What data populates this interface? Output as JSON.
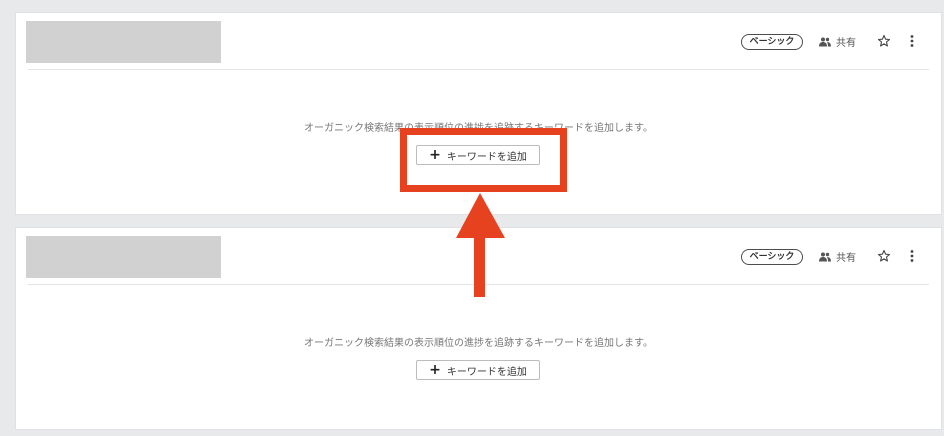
{
  "projects": [
    {
      "badge": "ベーシック",
      "share_label": "共有",
      "empty_message": "オーガニック検索結果の表示順位の進捗を追跡するキーワードを追加します。",
      "add_keyword_label": "キーワードを追加"
    },
    {
      "badge": "ベーシック",
      "share_label": "共有",
      "empty_message": "オーガニック検索結果の表示順位の進捗を追跡するキーワードを追加します。",
      "add_keyword_label": "キーワードを追加"
    }
  ],
  "icons": {
    "share": "people-icon",
    "favorite": "star-icon",
    "menu": "kebab-menu-icon",
    "add": "plus-icon"
  },
  "colors": {
    "highlight": "#e74220",
    "page_bg": "#e8e9eb",
    "placeholder_thumb": "#d1d1d1"
  }
}
